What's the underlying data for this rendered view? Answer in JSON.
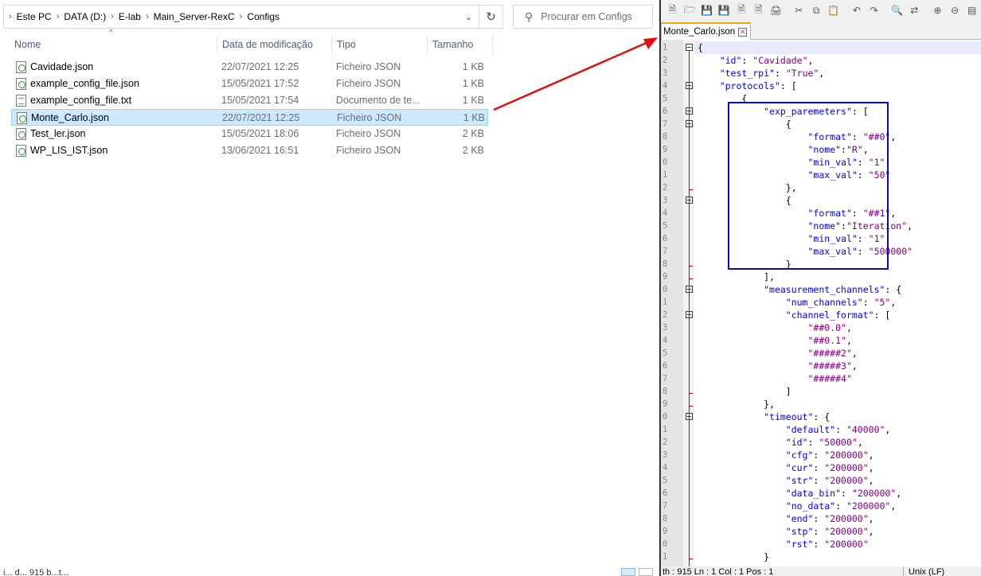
{
  "explorer": {
    "breadcrumb": [
      "Este PC",
      "DATA (D:)",
      "E-lab",
      "Main_Server-RexC",
      "Configs"
    ],
    "search_placeholder": "Procurar em Configs",
    "columns": {
      "name": "Nome",
      "date": "Data de modificação",
      "type": "Tipo",
      "size": "Tamanho"
    },
    "files": [
      {
        "name": "Cavidade.json",
        "date": "22/07/2021 12:25",
        "type": "Ficheiro JSON",
        "size": "1 KB",
        "icon": "json-file-icon"
      },
      {
        "name": "example_config_file.json",
        "date": "15/05/2021 17:52",
        "type": "Ficheiro JSON",
        "size": "1 KB",
        "icon": "json-file-icon"
      },
      {
        "name": "example_config_file.txt",
        "date": "15/05/2021 17:54",
        "type": "Documento de te...",
        "size": "1 KB",
        "icon": "text-file-icon"
      },
      {
        "name": "Monte_Carlo.json",
        "date": "22/07/2021 12:25",
        "type": "Ficheiro JSON",
        "size": "1 KB",
        "icon": "json-file-icon",
        "selected": true
      },
      {
        "name": "Test_ler.json",
        "date": "15/05/2021 18:06",
        "type": "Ficheiro JSON",
        "size": "2 KB",
        "icon": "json-file-icon"
      },
      {
        "name": "WP_LIS_IST.json",
        "date": "13/06/2021 16:51",
        "type": "Ficheiro JSON",
        "size": "2 KB",
        "icon": "json-file-icon"
      }
    ],
    "status_text": "i... d... 915 b...t..."
  },
  "notepad": {
    "tab_title": "Monte_Carlo.json",
    "status_left": "th : 915   Ln : 1    Col : 1    Pos : 1",
    "status_eol": "Unix (LF)",
    "line_numbers": [
      "1",
      "2",
      "3",
      "4",
      "5",
      "6",
      "7",
      "8",
      "9",
      "0",
      "1",
      "2",
      "3",
      "4",
      "5",
      "6",
      "7",
      "8",
      "9",
      "0",
      "1",
      "2",
      "3",
      "4",
      "5",
      "6",
      "7",
      "8",
      "9",
      "0",
      "1",
      "2",
      "3",
      "4",
      "5",
      "6",
      "7",
      "8",
      "9",
      "0",
      "1"
    ],
    "code_lines": [
      "{",
      "    \"id\": \"Cavidade\",",
      "    \"test_rpi\": \"True\",",
      "    \"protocols\": [",
      "        {",
      "            \"exp_paremeters\": [",
      "                {",
      "                    \"format\": \"##0\",",
      "                    \"nome\":\"R\",",
      "                    \"min_val\": \"1\",",
      "                    \"max_val\": \"50\"",
      "                },",
      "                {",
      "                    \"format\": \"##1\",",
      "                    \"nome\":\"Iteration\",",
      "                    \"min_val\": \"1\",",
      "                    \"max_val\": \"500000\"",
      "                }",
      "            ],",
      "            \"measurement_channels\": {",
      "                \"num_channels\": \"5\",",
      "                \"channel_format\": [",
      "                    \"##0.0\",",
      "                    \"##0.1\",",
      "                    \"#####2\",",
      "                    \"#####3\",",
      "                    \"#####4\"",
      "                ]",
      "            },",
      "            \"timeout\": {",
      "                \"default\": \"40000\",",
      "                \"id\": \"50000\",",
      "                \"cfg\": \"200000\",",
      "                \"cur\": \"200000\",",
      "                \"str\": \"200000\",",
      "                \"data_bin\": \"200000\",",
      "                \"no_data\": \"200000\",",
      "                \"end\": \"200000\",",
      "                \"stp\": \"200000\",",
      "                \"rst\": \"200000\"",
      "            }"
    ]
  },
  "colors": {
    "highlight_box": "#0a0ab4",
    "arrow": "#e01010",
    "selection": "#cce8ff"
  }
}
